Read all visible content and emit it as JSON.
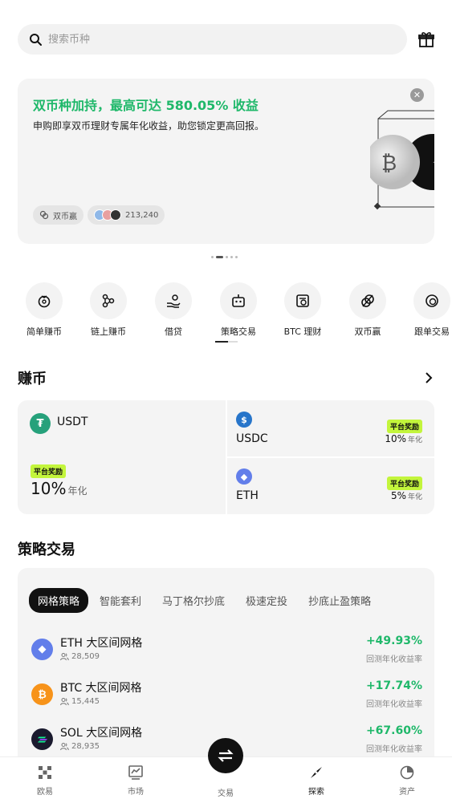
{
  "search": {
    "placeholder": "搜索币种"
  },
  "banner": {
    "title": "双币种加持，最高可达 580.05% 收益",
    "subtitle": "申购即享双币理财专属年化收益，助您锁定更高回报。",
    "chip_label": "双币赢",
    "participants": "213,240"
  },
  "quick_entries": [
    {
      "label": "简单赚币",
      "icon": "piggy-icon"
    },
    {
      "label": "链上赚币",
      "icon": "chain-icon"
    },
    {
      "label": "借贷",
      "icon": "loan-icon"
    },
    {
      "label": "策略交易",
      "icon": "robot-icon"
    },
    {
      "label": "BTC 理财",
      "icon": "btc-wallet-icon"
    },
    {
      "label": "双币赢",
      "icon": "dual-coin-icon"
    },
    {
      "label": "跟单交易",
      "icon": "copy-trade-icon"
    }
  ],
  "earn": {
    "title": "赚币",
    "usdt": {
      "name": "USDT",
      "tag": "平台奖励",
      "rate": "10%",
      "unit": "年化"
    },
    "usdc": {
      "name": "USDC",
      "tag": "平台奖励",
      "rate": "10%",
      "unit": "年化"
    },
    "eth": {
      "name": "ETH",
      "tag": "平台奖励",
      "rate": "5%",
      "unit": "年化"
    }
  },
  "strategy": {
    "title": "策略交易",
    "tabs": [
      "网格策略",
      "智能套利",
      "马丁格尔抄底",
      "极速定投",
      "抄底止盈策略"
    ],
    "rows": [
      {
        "name": "ETH 大区间网格",
        "count": "28,509",
        "pct": "+49.93%",
        "pct_label": "回测年化收益率"
      },
      {
        "name": "BTC 大区间网格",
        "count": "15,445",
        "pct": "+17.74%",
        "pct_label": "回测年化收益率"
      },
      {
        "name": "SOL 大区间网格",
        "count": "28,935",
        "pct": "+67.60%",
        "pct_label": "回测年化收益率"
      }
    ]
  },
  "nav": {
    "items": [
      "欧易",
      "市场",
      "交易",
      "探索",
      "资产"
    ]
  },
  "colors": {
    "accent_green": "#1fb86a",
    "tag_lime": "#c3f53c"
  }
}
